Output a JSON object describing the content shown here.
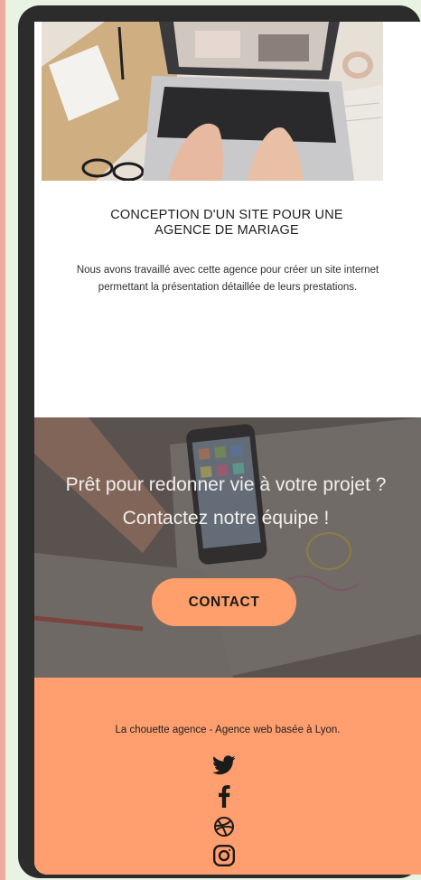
{
  "project": {
    "title_line1": "CONCEPTION D'UN SITE POUR UNE",
    "title_line2": "AGENCE DE MARIAGE",
    "description": "Nous avons travaillé avec cette agence pour créer un site internet permettant la présentation détaillée de leurs prestations."
  },
  "cta": {
    "line1": "Prêt pour redonner vie à votre projet ?",
    "line2": "Contactez notre équipe !",
    "button_label": "CONTACT"
  },
  "footer": {
    "tagline": "La chouette agence - Agence web basée à Lyon.",
    "social": [
      "twitter-icon",
      "facebook-icon",
      "dribbble-icon",
      "instagram-icon"
    ]
  },
  "colors": {
    "accent": "#ff9e6e",
    "frame": "#2c2c2c"
  }
}
